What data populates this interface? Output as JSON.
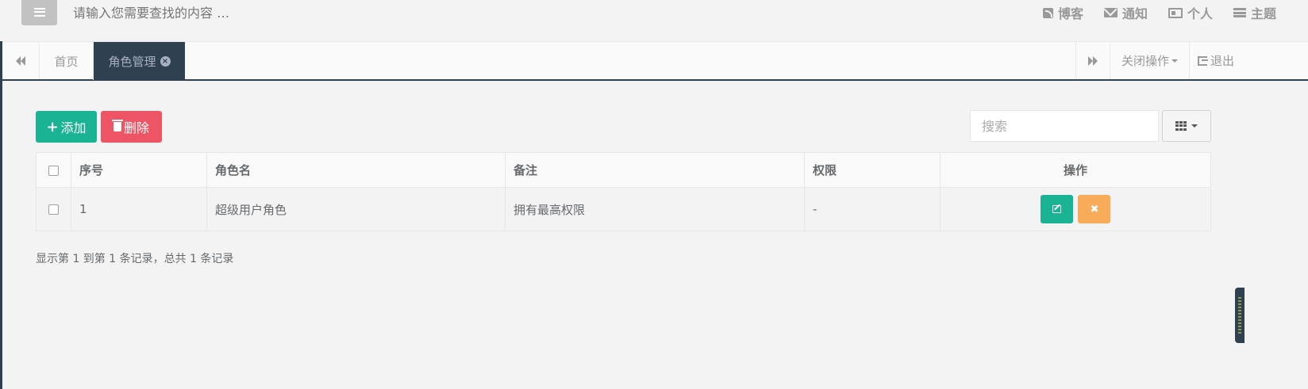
{
  "topbar": {
    "search_placeholder": "请输入您需要查找的内容 …",
    "links": [
      {
        "label": "博客",
        "icon": "rss-icon"
      },
      {
        "label": "通知",
        "icon": "envelope-icon"
      },
      {
        "label": "个人",
        "icon": "id-card-icon"
      },
      {
        "label": "主题",
        "icon": "theme-list-icon"
      }
    ]
  },
  "tabs": {
    "home_label": "首页",
    "active_label": "角色管理",
    "close_ops_label": "关闭操作",
    "logout_label": "退出"
  },
  "toolbar": {
    "add_label": "添加",
    "delete_label": "删除",
    "search_placeholder": "搜索"
  },
  "table": {
    "headers": [
      "序号",
      "角色名",
      "备注",
      "权限",
      "操作"
    ],
    "rows": [
      {
        "id": "1",
        "name": "超级用户角色",
        "note": "拥有最高权限",
        "perm": "-"
      }
    ]
  },
  "pager": {
    "info": "显示第 1 到第 1 条记录，总共 1 条记录"
  },
  "colors": {
    "primary": "#1ab394",
    "danger": "#ed5565",
    "warning": "#f8ac59",
    "nav_dark": "#2f4050"
  }
}
